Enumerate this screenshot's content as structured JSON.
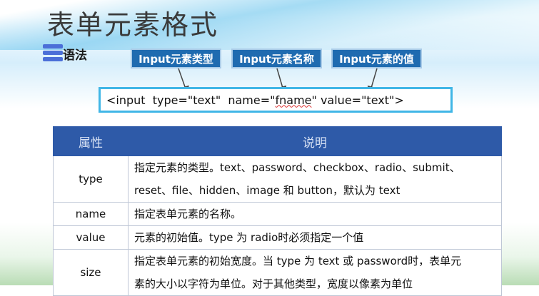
{
  "title": "表单元素格式",
  "syntax_label": "语法",
  "callouts": {
    "type_label": "Input元素类型",
    "name_label": "Input元素名称",
    "value_label": "Input元素的值"
  },
  "code": {
    "part1": "<input  type=\"text\"  name=\"",
    "part2": "fname",
    "part3": "\" value=\"text\">"
  },
  "table": {
    "headers": [
      "属性",
      "说明"
    ],
    "rows": [
      {
        "prop": "type",
        "desc_line1": "指定元素的类型。text、password、checkbox、radio、submit、",
        "desc_line2": "reset、file、hidden、image 和 button，默认为 text"
      },
      {
        "prop": "name",
        "desc": "指定表单元素的名称。"
      },
      {
        "prop": "value",
        "desc": "元素的初始值。type 为 radio时必须指定一个值"
      },
      {
        "prop": "size",
        "desc_line1": "指定表单元素的初始宽度。当 type 为 text 或 password时，表单元",
        "desc_line2": "素的大小以字符为单位。对于其他类型，宽度以像素为单位"
      }
    ]
  },
  "colors": {
    "header_bg": "#2e5aa8",
    "callout_bg": "#1f6bb0",
    "code_border": "#40b6e6",
    "bullet": "#4b6fd8"
  }
}
